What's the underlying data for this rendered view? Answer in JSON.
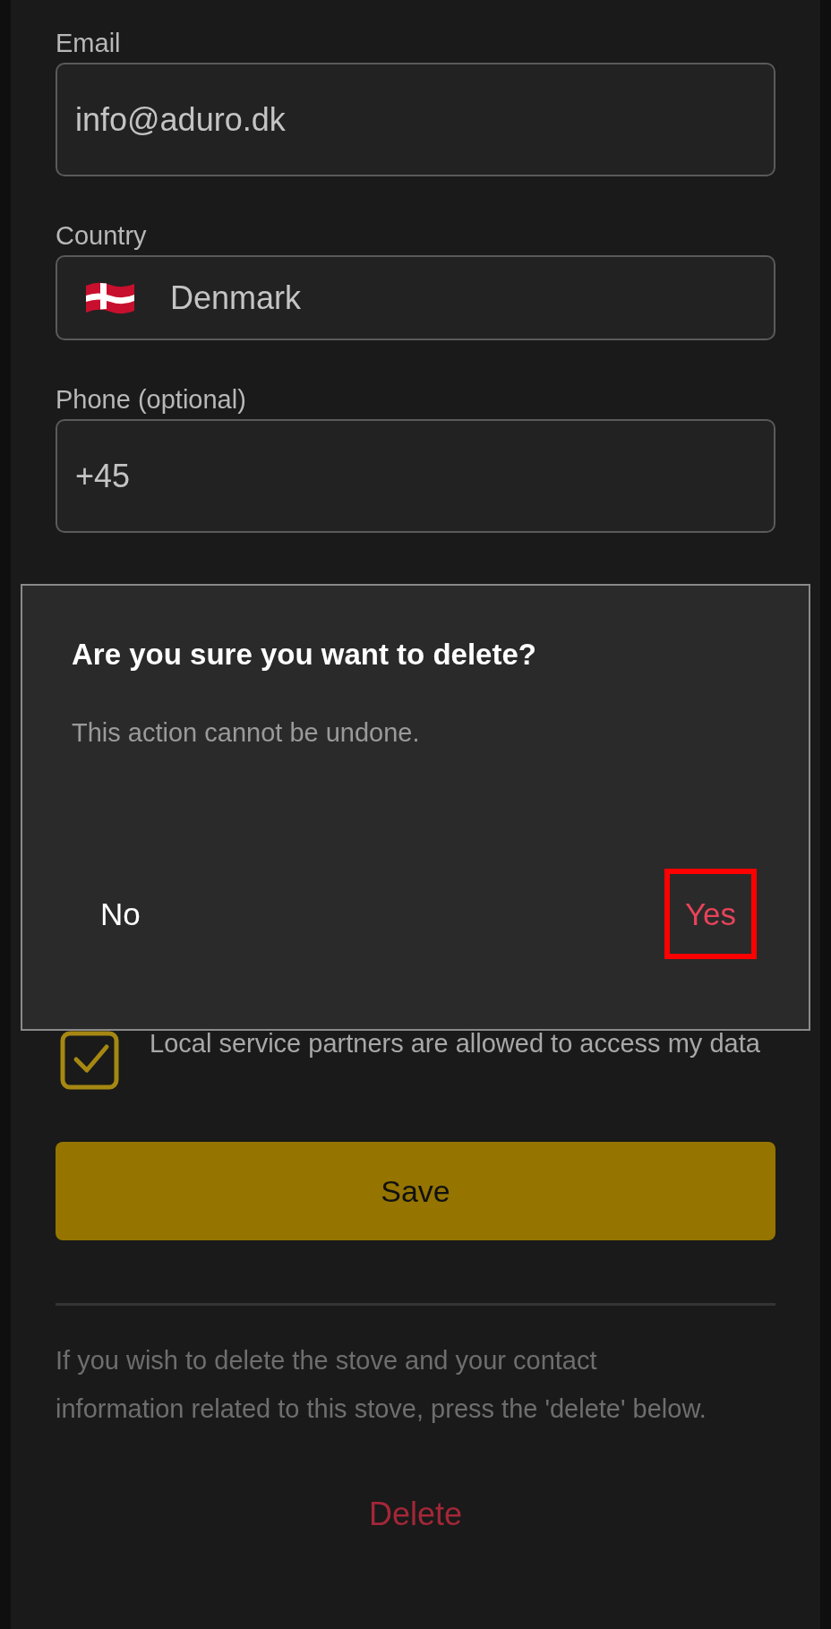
{
  "form": {
    "fields": [
      {
        "label": "Email",
        "kind": "text",
        "value": "info@aduro.dk"
      },
      {
        "label": "Country",
        "kind": "country",
        "value": "Denmark"
      },
      {
        "label": "Phone (optional)",
        "kind": "text",
        "value": "+45"
      }
    ],
    "consent": {
      "label": "Local service partners are allowed to access my data",
      "checked": true
    },
    "save_button": "Save",
    "note": "If you wish to delete the stove and your contact information related to this stove, press the 'delete' below.",
    "delete_link": "Delete"
  },
  "dialog": {
    "title": "Are you sure you want to delete?",
    "message": "This action cannot be undone.",
    "buttons": [
      {
        "label": "No",
        "kind": "neutral",
        "highlighted": false
      },
      {
        "label": "Yes",
        "kind": "danger",
        "highlighted": true
      }
    ]
  }
}
